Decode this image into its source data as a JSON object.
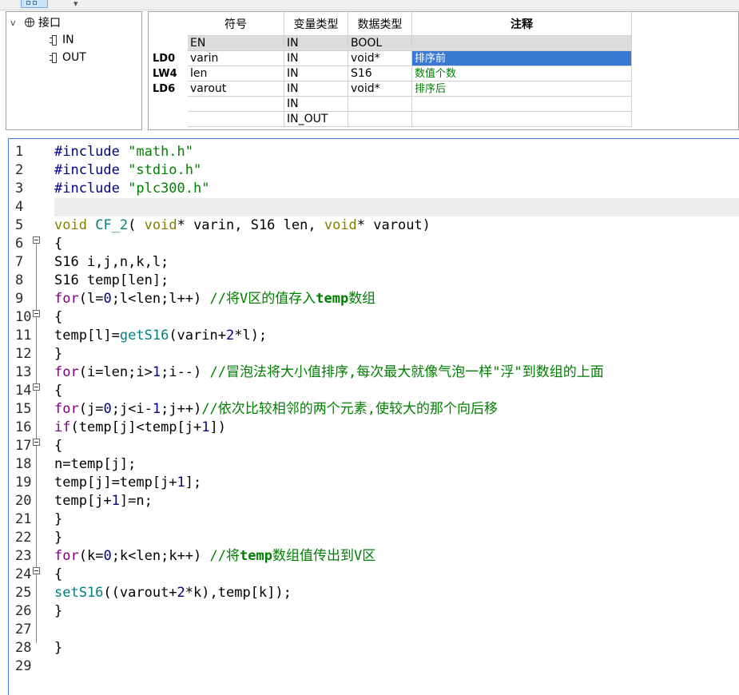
{
  "tree": {
    "root": "接口",
    "children": [
      "IN",
      "OUT"
    ]
  },
  "var_table": {
    "headers": [
      "符号",
      "变量类型",
      "数据类型",
      "注释"
    ],
    "row_headers": [
      "LD0",
      "LW4",
      "LD6"
    ],
    "rows": [
      {
        "symbol": "EN",
        "var_type": "IN",
        "data_type": "BOOL",
        "comment": ""
      },
      {
        "symbol": "varin",
        "var_type": "IN",
        "data_type": "void*",
        "comment": "排序前"
      },
      {
        "symbol": "len",
        "var_type": "IN",
        "data_type": "S16",
        "comment": "数值个数"
      },
      {
        "symbol": "varout",
        "var_type": "IN",
        "data_type": "void*",
        "comment": "排序后"
      },
      {
        "symbol": "",
        "var_type": "IN",
        "data_type": "",
        "comment": ""
      },
      {
        "symbol": "",
        "var_type": "IN_OUT",
        "data_type": "",
        "comment": ""
      }
    ]
  },
  "editor": {
    "lines": [
      {
        "n": "1",
        "tokens": [
          {
            "c": "kw",
            "t": "#include "
          },
          {
            "c": "str",
            "t": "\"math.h\""
          }
        ]
      },
      {
        "n": "2",
        "tokens": [
          {
            "c": "kw",
            "t": "#include "
          },
          {
            "c": "str",
            "t": "\"stdio.h\""
          }
        ]
      },
      {
        "n": "3",
        "tokens": [
          {
            "c": "kw",
            "t": "#include "
          },
          {
            "c": "str",
            "t": "\"plc300.h\""
          }
        ]
      },
      {
        "n": "4",
        "tokens": []
      },
      {
        "n": "5",
        "tokens": [
          {
            "c": "tp",
            "t": "void"
          },
          {
            "c": "",
            "t": " "
          },
          {
            "c": "fn",
            "t": "CF_2"
          },
          {
            "c": "",
            "t": "( "
          },
          {
            "c": "tp",
            "t": "void"
          },
          {
            "c": "",
            "t": "* varin, S16 len, "
          },
          {
            "c": "tp",
            "t": "void"
          },
          {
            "c": "",
            "t": "* varout)"
          }
        ]
      },
      {
        "n": "6",
        "tokens": [
          {
            "c": "",
            "t": "{"
          }
        ]
      },
      {
        "n": "7",
        "tokens": [
          {
            "c": "",
            "t": "S16 i,j,n,k,l;"
          }
        ]
      },
      {
        "n": "8",
        "tokens": [
          {
            "c": "",
            "t": "S16 temp[len];"
          }
        ]
      },
      {
        "n": "9",
        "tokens": [
          {
            "c": "for",
            "t": "for"
          },
          {
            "c": "",
            "t": "(l="
          },
          {
            "c": "num",
            "t": "0"
          },
          {
            "c": "",
            "t": ";l<len;l++) "
          },
          {
            "c": "cm",
            "t": "//将V区的值存入"
          },
          {
            "c": "cmb",
            "t": "temp"
          },
          {
            "c": "cm",
            "t": "数组"
          }
        ]
      },
      {
        "n": "10",
        "tokens": [
          {
            "c": "",
            "t": "{"
          }
        ]
      },
      {
        "n": "11",
        "tokens": [
          {
            "c": "",
            "t": "temp[l]="
          },
          {
            "c": "fn",
            "t": "getS16"
          },
          {
            "c": "",
            "t": "(varin+"
          },
          {
            "c": "num",
            "t": "2"
          },
          {
            "c": "",
            "t": "*l);"
          }
        ]
      },
      {
        "n": "12",
        "tokens": [
          {
            "c": "",
            "t": "}"
          }
        ]
      },
      {
        "n": "13",
        "tokens": [
          {
            "c": "for",
            "t": "for"
          },
          {
            "c": "",
            "t": "(i=len;i>"
          },
          {
            "c": "num",
            "t": "1"
          },
          {
            "c": "",
            "t": ";i--) "
          },
          {
            "c": "cm",
            "t": "//冒泡法将大小值排序,每次最大就像气泡一样\"浮\"到数组的上面"
          }
        ]
      },
      {
        "n": "14",
        "tokens": [
          {
            "c": "",
            "t": "{"
          }
        ]
      },
      {
        "n": "15",
        "tokens": [
          {
            "c": "for",
            "t": "for"
          },
          {
            "c": "",
            "t": "(j="
          },
          {
            "c": "num",
            "t": "0"
          },
          {
            "c": "",
            "t": ";j<i-"
          },
          {
            "c": "num",
            "t": "1"
          },
          {
            "c": "",
            "t": ";j++)"
          },
          {
            "c": "cm",
            "t": "//依次比较相邻的两个元素,使较大的那个向后移"
          }
        ]
      },
      {
        "n": "16",
        "tokens": [
          {
            "c": "for",
            "t": "if"
          },
          {
            "c": "",
            "t": "(temp[j]<temp[j+"
          },
          {
            "c": "num",
            "t": "1"
          },
          {
            "c": "",
            "t": "])"
          }
        ]
      },
      {
        "n": "17",
        "tokens": [
          {
            "c": "",
            "t": "{"
          }
        ]
      },
      {
        "n": "18",
        "tokens": [
          {
            "c": "",
            "t": "n=temp[j];"
          }
        ]
      },
      {
        "n": "19",
        "tokens": [
          {
            "c": "",
            "t": "temp[j]=temp[j+"
          },
          {
            "c": "num",
            "t": "1"
          },
          {
            "c": "",
            "t": "];"
          }
        ]
      },
      {
        "n": "20",
        "tokens": [
          {
            "c": "",
            "t": "temp[j+"
          },
          {
            "c": "num",
            "t": "1"
          },
          {
            "c": "",
            "t": "]=n;"
          }
        ]
      },
      {
        "n": "21",
        "tokens": [
          {
            "c": "",
            "t": "}"
          }
        ]
      },
      {
        "n": "22",
        "tokens": [
          {
            "c": "",
            "t": "}"
          }
        ]
      },
      {
        "n": "23",
        "tokens": [
          {
            "c": "for",
            "t": "for"
          },
          {
            "c": "",
            "t": "(k="
          },
          {
            "c": "num",
            "t": "0"
          },
          {
            "c": "",
            "t": ";k<len;k++) "
          },
          {
            "c": "cm",
            "t": "//将"
          },
          {
            "c": "cmb",
            "t": "temp"
          },
          {
            "c": "cm",
            "t": "数组值传出到V区"
          }
        ]
      },
      {
        "n": "24",
        "tokens": [
          {
            "c": "",
            "t": "{"
          }
        ]
      },
      {
        "n": "25",
        "tokens": [
          {
            "c": "fn",
            "t": "setS16"
          },
          {
            "c": "",
            "t": "((varout+"
          },
          {
            "c": "num",
            "t": "2"
          },
          {
            "c": "",
            "t": "*k),temp[k]);"
          }
        ]
      },
      {
        "n": "26",
        "tokens": [
          {
            "c": "",
            "t": "}"
          }
        ]
      },
      {
        "n": "27",
        "tokens": []
      },
      {
        "n": "28",
        "tokens": [
          {
            "c": "",
            "t": "}"
          }
        ]
      },
      {
        "n": "29",
        "tokens": []
      }
    ]
  }
}
